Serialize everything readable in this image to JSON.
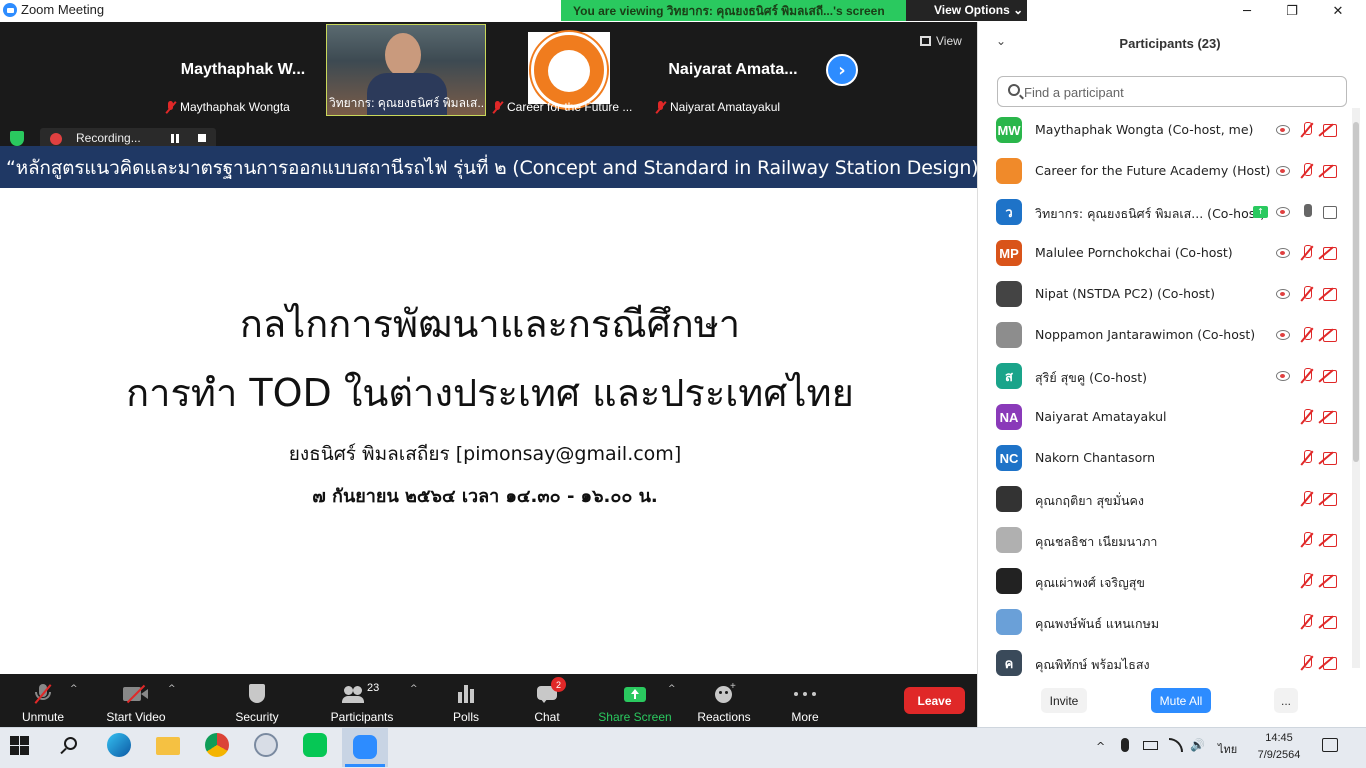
{
  "window": {
    "app_title": "Zoom Meeting",
    "share_banner": "You are viewing วิทยากร: คุณยงธนิศร์ พิมลเสถี...'s screen",
    "view_options": "View Options",
    "controls": {
      "minimize": "─",
      "maximize": "❐",
      "close": "✕"
    }
  },
  "gallery": {
    "tiles": [
      {
        "display_name": "Maythaphak  W...",
        "label": "Maythaphak Wongta",
        "muted": true
      },
      {
        "display_name": "",
        "label": "วิทยากร: คุณยงธนิศร์ พิมลเส...",
        "muted": false,
        "video": true
      },
      {
        "display_name": "",
        "label": "Career for the Future ...",
        "muted": true,
        "logo": true
      },
      {
        "display_name": "Naiyarat  Amata...",
        "label": "Naiyarat Amatayakul",
        "muted": true
      }
    ],
    "next_arrow": "›",
    "view_label": "View"
  },
  "recording": {
    "label": "Recording..."
  },
  "slide": {
    "header": "“หลักสูตรแนวคิดและมาตรฐานการออกแบบสถานีรถไฟ รุ่นที่ ๒ (Concept and Standard in Railway Station Design)”",
    "title_line1": "กลไกการพัฒนาและกรณีศึกษา",
    "title_line2": "การทำ TOD ในต่างประเทศ และประเทศไทย",
    "author": "ยงธนิศร์ พิมลเสถียร [pimonsay@gmail.com]",
    "date": "๗ กันยายน ๒๕๖๔ เวลา ๑๔.๓๐ - ๑๖.๐๐ น."
  },
  "toolbar": {
    "unmute": "Unmute",
    "start_video": "Start Video",
    "security": "Security",
    "participants": "Participants",
    "participants_count": "23",
    "polls": "Polls",
    "chat": "Chat",
    "chat_badge": "2",
    "share_screen": "Share Screen",
    "reactions": "Reactions",
    "more": "More",
    "leave": "Leave",
    "caret": "^"
  },
  "panel": {
    "title": "Participants (23)",
    "collapse": "⌄",
    "search_placeholder": "Find a participant",
    "participants": [
      {
        "name": "Maythaphak Wongta (Co-host, me)",
        "initials": "MW",
        "color": "#2ab64b",
        "recording": true,
        "mic_on": false,
        "cam_on": false
      },
      {
        "name": "Career for the Future Academy (Host)",
        "initials": "",
        "color": "#f08a2a",
        "recording": true,
        "mic_on": false,
        "cam_on": false
      },
      {
        "name": "วิทยากร: คุณยงธนิศร์ พิมลเส... (Co-host)",
        "initials": "ว",
        "color": "#1e73c8",
        "recording": true,
        "mic_on": true,
        "cam_on": true,
        "sharing": true
      },
      {
        "name": "Malulee Pornchokchai (Co-host)",
        "initials": "MP",
        "color": "#d9541a",
        "recording": true,
        "mic_on": false,
        "cam_on": false
      },
      {
        "name": "Nipat (NSTDA PC2) (Co-host)",
        "initials": "",
        "color": "#444444",
        "recording": true,
        "mic_on": false,
        "cam_on": false
      },
      {
        "name": "Noppamon Jantarawimon (Co-host)",
        "initials": "",
        "color": "#8d8d8d",
        "recording": true,
        "mic_on": false,
        "cam_on": false
      },
      {
        "name": "สุริย์ สุขคู (Co-host)",
        "initials": "ส",
        "color": "#1aa48a",
        "recording": true,
        "mic_on": false,
        "cam_on": false
      },
      {
        "name": "Naiyarat Amatayakul",
        "initials": "NA",
        "color": "#8a3ab9",
        "recording": false,
        "mic_on": false,
        "cam_on": false
      },
      {
        "name": "Nakorn Chantasorn",
        "initials": "NC",
        "color": "#1e73c8",
        "recording": false,
        "mic_on": false,
        "cam_on": false
      },
      {
        "name": "คุณกฤติยา สุขมั่นคง",
        "initials": "",
        "color": "#333333",
        "recording": false,
        "mic_on": false,
        "cam_on": false
      },
      {
        "name": "คุณชลธิชา เนียมนาภา",
        "initials": "",
        "color": "#b0b0b0",
        "recording": false,
        "mic_on": false,
        "cam_on": false
      },
      {
        "name": "คุณเผ่าพงศ์ เจริญสุข",
        "initials": "",
        "color": "#222222",
        "recording": false,
        "mic_on": false,
        "cam_on": false
      },
      {
        "name": "คุณพงษ์พันธ์ แหนเกษม",
        "initials": "",
        "color": "#6aa0d8",
        "recording": false,
        "mic_on": false,
        "cam_on": false
      },
      {
        "name": "คุณพิทักษ์ พร้อมไธสง",
        "initials": "ค",
        "color": "#3a4a5a",
        "recording": false,
        "mic_on": false,
        "cam_on": false
      }
    ],
    "invite": "Invite",
    "mute_all": "Mute All",
    "more": "..."
  },
  "taskbar": {
    "language": "ไทย",
    "time": "14:45",
    "date": "7/9/2564"
  }
}
